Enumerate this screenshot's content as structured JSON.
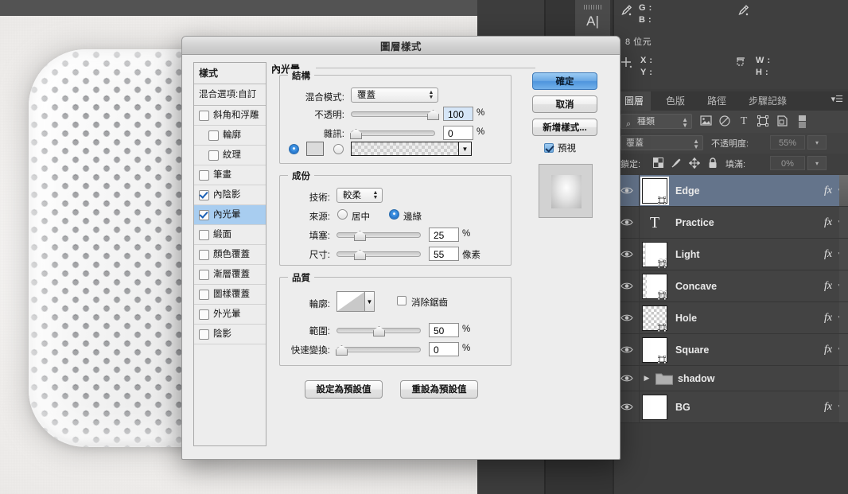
{
  "document": {
    "artwork_name": "speaker-grille-artwork"
  },
  "info_panel": {
    "eyedropper1_icon": "eyedropper-icon",
    "eyedropper2_icon": "eyedropper-icon",
    "position_icon": "crosshair-icon",
    "selection_icon": "selection-size-icon",
    "g_label": "G :",
    "b_label": "B :",
    "bit_depth": "8 位元",
    "x_label": "X :",
    "y_label": "Y :",
    "w_label": "W :",
    "h_label": "H :"
  },
  "character_tab": {
    "label": "A|"
  },
  "layers_panel": {
    "tabs": [
      {
        "label": "圖層",
        "active": true
      },
      {
        "label": "色版",
        "active": false
      },
      {
        "label": "路徑",
        "active": false
      },
      {
        "label": "步驟記錄",
        "active": false
      }
    ],
    "menu_icon": "panel-menu-icon",
    "filter": {
      "search_icon": "search-icon",
      "value": "種類",
      "icons": [
        "image-filter-icon",
        "adjustment-filter-icon",
        "type-filter-icon",
        "shape-filter-icon",
        "smartobject-filter-icon",
        "toggle-filter-icon"
      ]
    },
    "blend_mode": "覆蓋",
    "opacity_label": "不透明度:",
    "opacity_value": "55%",
    "lock_label": "鎖定:",
    "lock_icons": [
      "lock-transparency-icon",
      "lock-image-icon",
      "lock-position-icon",
      "lock-all-icon"
    ],
    "fill_label": "填滿:",
    "fill_value": "0%",
    "fx_glyph": "fx",
    "layers": [
      {
        "name": "Edge",
        "type": "shape",
        "selected": true,
        "has_fx": true,
        "visible": true,
        "thumb": "white-shape"
      },
      {
        "name": "Practice",
        "type": "text",
        "selected": false,
        "has_fx": true,
        "visible": true,
        "thumb": "type-T"
      },
      {
        "name": "Light",
        "type": "shape",
        "selected": false,
        "has_fx": true,
        "visible": true,
        "thumb": "transparent-shape"
      },
      {
        "name": "Concave",
        "type": "shape",
        "selected": false,
        "has_fx": true,
        "visible": true,
        "thumb": "transparent-shape"
      },
      {
        "name": "Hole",
        "type": "shape",
        "selected": false,
        "has_fx": true,
        "visible": true,
        "thumb": "checker-shape"
      },
      {
        "name": "Square",
        "type": "shape",
        "selected": false,
        "has_fx": true,
        "visible": true,
        "thumb": "white-shape"
      },
      {
        "name": "shadow",
        "type": "group",
        "selected": false,
        "has_fx": false,
        "visible": true,
        "thumb": "folder"
      },
      {
        "name": "BG",
        "type": "raster",
        "selected": false,
        "has_fx": true,
        "visible": true,
        "thumb": "white-fill"
      }
    ]
  },
  "dialog": {
    "title": "圖層樣式",
    "styles_list": {
      "header": "樣式",
      "blending_options": "混合選項:自訂",
      "items": [
        {
          "label": "斜角和浮雕",
          "checked": false,
          "indent": false,
          "active": false
        },
        {
          "label": "輪廓",
          "checked": false,
          "indent": true,
          "active": false
        },
        {
          "label": "紋理",
          "checked": false,
          "indent": true,
          "active": false
        },
        {
          "label": "筆畫",
          "checked": false,
          "indent": false,
          "active": false
        },
        {
          "label": "內陰影",
          "checked": true,
          "indent": false,
          "active": false
        },
        {
          "label": "內光暈",
          "checked": true,
          "indent": false,
          "active": true
        },
        {
          "label": "緞面",
          "checked": false,
          "indent": false,
          "active": false
        },
        {
          "label": "顏色覆蓋",
          "checked": false,
          "indent": false,
          "active": false
        },
        {
          "label": "漸層覆蓋",
          "checked": false,
          "indent": false,
          "active": false
        },
        {
          "label": "圖樣覆蓋",
          "checked": false,
          "indent": false,
          "active": false
        },
        {
          "label": "外光暈",
          "checked": false,
          "indent": false,
          "active": false
        },
        {
          "label": "陰影",
          "checked": false,
          "indent": false,
          "active": false
        }
      ]
    },
    "panel_title": "內光暈",
    "structure": {
      "title": "結構",
      "blend_mode_label": "混合模式:",
      "blend_mode_value": "覆蓋",
      "opacity_label": "不透明:",
      "opacity_value": "100",
      "opacity_unit": "%",
      "noise_label": "雜訊:",
      "noise_value": "0",
      "noise_unit": "%",
      "fill_type": "color",
      "color_swatch": "#dbdbdb",
      "gradient_label": "gradient-preview"
    },
    "elements": {
      "title": "成份",
      "technique_label": "技術:",
      "technique_value": "較柔",
      "source_label": "來源:",
      "source_center": "居中",
      "source_edge": "邊緣",
      "source_selected": "邊緣",
      "choke_label": "填塞:",
      "choke_value": "25",
      "choke_unit": "%",
      "size_label": "尺寸:",
      "size_value": "55",
      "size_unit": "像素"
    },
    "quality": {
      "title": "品質",
      "contour_label": "輪廓:",
      "antialias_label": "消除鋸齒",
      "antialias_checked": false,
      "range_label": "範圍:",
      "range_value": "50",
      "range_unit": "%",
      "jitter_label": "快速變換:",
      "jitter_value": "0",
      "jitter_unit": "%"
    },
    "footer_buttons": {
      "set_default": "設定為預設值",
      "reset_default": "重設為預設值"
    },
    "right_buttons": {
      "ok": "確定",
      "cancel": "取消",
      "new_style": "新增樣式...",
      "preview_label": "預視",
      "preview_checked": true
    }
  },
  "colors": {
    "accent_blue": "#6ba9e4",
    "selection_blue": "#a8cdf0",
    "layer_selected": "#64748b",
    "panel_dark": "#3d3d3d",
    "dialog_bg": "#ededed"
  }
}
